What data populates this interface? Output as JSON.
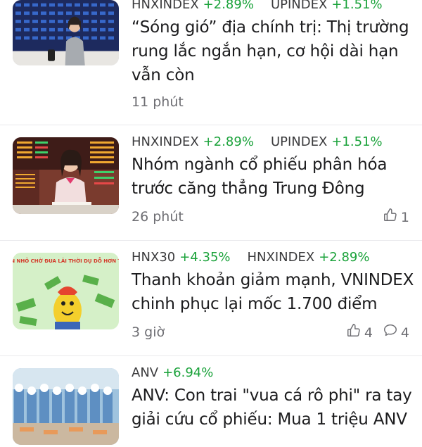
{
  "feed": {
    "articles": [
      {
        "tickers": [
          {
            "symbol": "HNXINDEX",
            "change": "+2.89%"
          },
          {
            "symbol": "UPINDEX",
            "change": "+1.51%"
          }
        ],
        "headline": "“Sóng gió” địa chính trị: Thị trường rung lắc ngắn hạn, cơ hội dài hạn vẫn còn",
        "time": "11 phút"
      },
      {
        "tickers": [
          {
            "symbol": "HNXINDEX",
            "change": "+2.89%"
          },
          {
            "symbol": "UPINDEX",
            "change": "+1.51%"
          }
        ],
        "headline": "Nhóm ngành cổ phiếu phân hóa trước căng thẳng Trung Đông",
        "time": "26 phút",
        "likes": "1"
      },
      {
        "tickers": [
          {
            "symbol": "HNX30",
            "change": "+4.35%"
          },
          {
            "symbol": "HNXINDEX",
            "change": "+2.89%"
          }
        ],
        "headline": "Thanh khoản giảm mạnh, VNINDEX chinh phục lại mốc 1.700 điểm",
        "time": "3 giờ",
        "likes": "4",
        "comments": "4",
        "thumb_text": "GIÁ TĂNG, VỐN NHỎ CHỜ ĐUA LÃI THỜI DỤ DỖ HƠN THUA ĐƯỢC GÌ"
      },
      {
        "tickers": [
          {
            "symbol": "ANV",
            "change": "+6.94%"
          }
        ],
        "headline": "ANV: Con trai \"vua cá rô phi\" ra tay giải cứu cổ phiếu: Mua 1 triệu ANV"
      }
    ]
  },
  "colors": {
    "positive": "#1aa23a",
    "text": "#1c1c1e",
    "muted": "#6e6e73",
    "divider": "#e9e9ec"
  },
  "icons": {
    "like": "thumbs-up-icon",
    "comment": "comment-icon"
  }
}
